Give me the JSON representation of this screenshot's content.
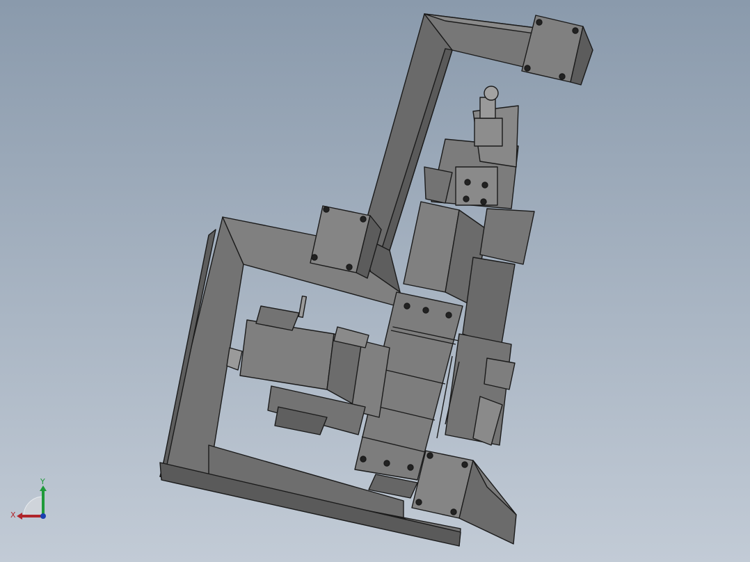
{
  "viewport": {
    "background_top": "#8a9aac",
    "background_bottom": "#c2cbd6"
  },
  "model": {
    "shade_color": "#7a7a7a",
    "edge_color": "#1a1a1a"
  },
  "triad": {
    "x_label": "X",
    "y_label": "Y",
    "x_color": "#b0252b",
    "y_color": "#1f9a3a",
    "z_color": "#1a3fb0"
  }
}
